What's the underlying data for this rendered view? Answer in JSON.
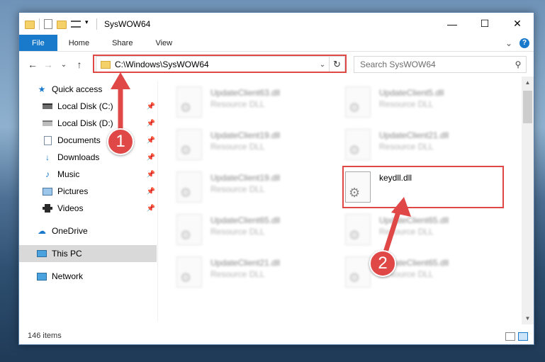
{
  "window": {
    "title": "SysWOW64",
    "caption": {
      "minimize": "—",
      "maximize": "☐",
      "close": "✕"
    }
  },
  "ribbon": {
    "tabs": [
      "File",
      "Home",
      "Share",
      "View"
    ],
    "expand": "⌄",
    "help": "?"
  },
  "nav": {
    "back": "←",
    "forward": "→",
    "recent": "⌄",
    "up": "↑",
    "address": "C:\\Windows\\SysWOW64",
    "address_dropdown": "⌄",
    "refresh": "↻",
    "search_placeholder": "Search SysWOW64",
    "search_icon": "⚲"
  },
  "sidebar": {
    "quick_access": "Quick access",
    "items": [
      {
        "label": "Local Disk (C:)",
        "icon": "drive-icon"
      },
      {
        "label": "Local Disk (D:)",
        "icon": "drive-icon"
      },
      {
        "label": "Documents",
        "icon": "documents-icon"
      },
      {
        "label": "Downloads",
        "icon": "downloads-icon"
      },
      {
        "label": "Music",
        "icon": "music-icon"
      },
      {
        "label": "Pictures",
        "icon": "pictures-icon"
      },
      {
        "label": "Videos",
        "icon": "videos-icon"
      }
    ],
    "onedrive": "OneDrive",
    "this_pc": "This PC",
    "network": "Network"
  },
  "files": [
    {
      "name": "UpdateClient63.dll",
      "type": "Resource DLL"
    },
    {
      "name": "UpdateClient5.dll",
      "type": "Resource DLL"
    },
    {
      "name": "UpdateClient19.dll",
      "type": "Resource DLL"
    },
    {
      "name": "UpdateClient21.dll",
      "type": "Resource DLL"
    },
    {
      "name": "UpdateClient19.dll",
      "type": "Resource DLL"
    },
    {
      "name": "keydll.dll",
      "type": ""
    },
    {
      "name": "UpdateClient65.dll",
      "type": "Resource DLL"
    },
    {
      "name": "UpdateClient65.dll",
      "type": "Resource DLL"
    },
    {
      "name": "UpdateClient21.dll",
      "type": "Resource DLL"
    },
    {
      "name": "UpdateClient65.dll",
      "type": "Resource DLL"
    }
  ],
  "status": {
    "count": "146 items"
  },
  "annotations": {
    "badge1": "1",
    "badge2": "2",
    "color": "#e04848"
  }
}
